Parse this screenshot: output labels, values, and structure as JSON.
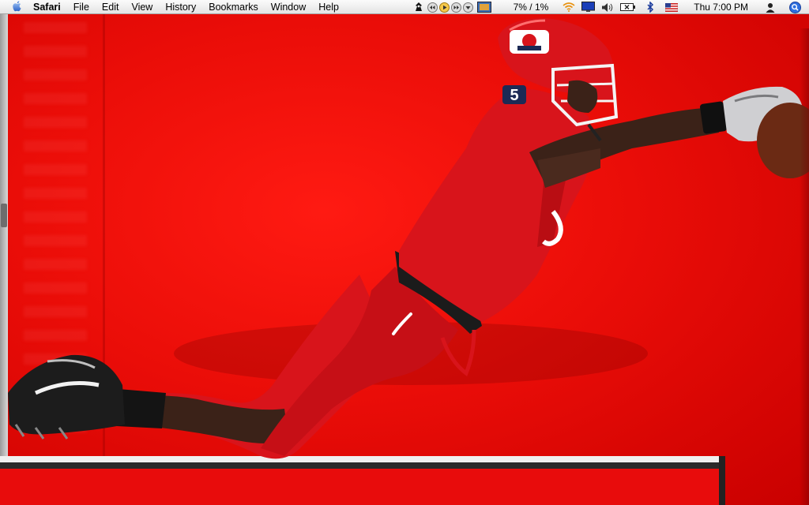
{
  "menubar": {
    "apple_icon": "apple-icon",
    "app_name": "Safari",
    "items": [
      "File",
      "Edit",
      "View",
      "History",
      "Bookmarks",
      "Window",
      "Help"
    ]
  },
  "status": {
    "cpu_text": "7% / 1%",
    "clock": "Thu 7:00 PM",
    "icons": [
      "script-icon",
      "rewind-icon",
      "play-icon",
      "forward-icon",
      "dropdown-icon",
      "itunes-icon",
      "wifi-icon",
      "display-icon",
      "volume-icon",
      "battery-icon",
      "bluetooth-icon",
      "us-flag-icon",
      "user-icon",
      "spotlight-icon"
    ]
  },
  "desktop": {
    "jersey_number": "5",
    "colors": {
      "background_red": "#e60a08",
      "jersey_red": "#d8141b",
      "skin": "#3b2218",
      "accent": "#1b1b1b"
    }
  }
}
